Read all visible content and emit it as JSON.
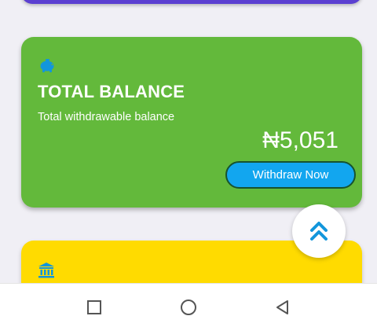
{
  "balance_card": {
    "title": "TOTAL BALANCE",
    "subtitle": "Total withdrawable balance",
    "amount": "₦5,051",
    "withdraw_label": "Withdraw Now",
    "icon": "piggy-bank-icon",
    "color": "#63b93b"
  },
  "top_card": {
    "color": "#5b3fd1"
  },
  "bank_card": {
    "icon": "bank-icon",
    "color": "#ffdb00"
  },
  "scroll_top_button": {
    "icon": "double-chevron-up-icon",
    "icon_color": "#1296db"
  },
  "nav_bar": {
    "items": [
      {
        "name": "recents",
        "icon": "square-icon"
      },
      {
        "name": "home",
        "icon": "circle-icon"
      },
      {
        "name": "back",
        "icon": "triangle-back-icon"
      }
    ]
  },
  "colors": {
    "accent_blue": "#12a6ef",
    "background": "#f0eff5"
  }
}
